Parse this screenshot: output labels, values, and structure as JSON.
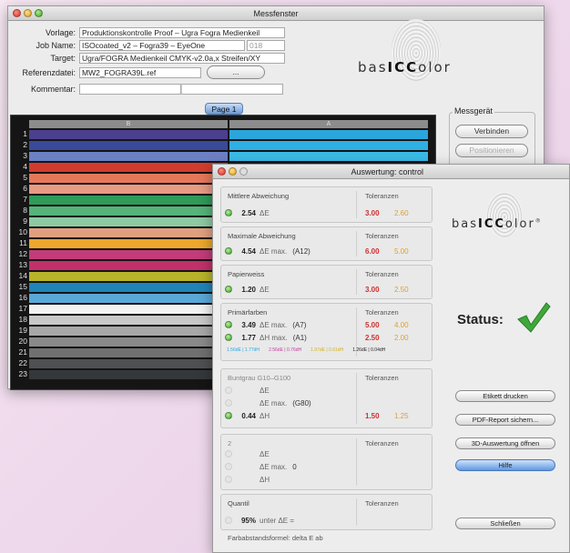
{
  "main": {
    "title": "Messfenster",
    "form": {
      "vorlage_label": "Vorlage:",
      "vorlage": "Produktionskontrolle Proof – Ugra Fogra Medienkeil",
      "job_label": "Job Name:",
      "job": "ISOcoated_v2 – Fogra39 – EyeOne",
      "job_num": "018",
      "target_label": "Target:",
      "target": "Ugra/FOGRA Medienkeil CMYK-v2.0a,x Streifen/XY",
      "ref_label": "Referenzdatei:",
      "ref": "MW2_FOGRA39L.ref",
      "browse": "...",
      "comment_label": "Kommentar:",
      "comment": ""
    },
    "logo": {
      "pre": "bas",
      "mid": "ICC",
      "post": "olor"
    },
    "page_tab": "Page 1",
    "col_b": "B",
    "col_a": "A",
    "rows": [
      "1",
      "2",
      "3",
      "4",
      "5",
      "6",
      "7",
      "8",
      "9",
      "10",
      "11",
      "12",
      "13",
      "14",
      "15",
      "16",
      "17",
      "18",
      "19",
      "20",
      "21",
      "22",
      "23"
    ],
    "colors_b": [
      "#4b3f8f",
      "#3a4a9a",
      "#6c80c4",
      "#d23c2e",
      "#e6785a",
      "#e89a84",
      "#2f9a5a",
      "#56b37a",
      "#8dcaa2",
      "#e0a080",
      "#eda72c",
      "#c23c7a",
      "#c2306a",
      "#b8b42a",
      "#1f84b8",
      "#5aa8d8",
      "#f2f2f2",
      "#c8c8c8",
      "#a8a8a8",
      "#8a8a8a",
      "#707070",
      "#4e5052",
      "#34383a"
    ],
    "colors_a": [
      "#2aa6dc",
      "#2fb0e4",
      "#3bbbe8"
    ],
    "messgeraet": "Messgerät",
    "verbinden": "Verbinden",
    "positionieren": "Positionieren"
  },
  "eval": {
    "title": "Auswertung: control",
    "logo": {
      "pre": "bas",
      "mid": "ICC",
      "post": "olor",
      "reg": "®"
    },
    "status": "Status:",
    "tol": "Toleranzen",
    "s1": {
      "title": "Mittlere Abweichung",
      "v": "2.54",
      "u": "ΔE",
      "t1": "3.00",
      "t2": "2.60"
    },
    "s2": {
      "title": "Maximale Abweichung",
      "v": "4.54",
      "u": "ΔE max.",
      "p": "(A12)",
      "t1": "6.00",
      "t2": "5.00"
    },
    "s3": {
      "title": "Papierweiss",
      "v": "1.20",
      "u": "ΔE",
      "t1": "3.00",
      "t2": "2.50"
    },
    "s4": {
      "title": "Primärfarben",
      "v1": "3.49",
      "u1": "ΔE max.",
      "p1": "(A7)",
      "t11": "5.00",
      "t12": "4.00",
      "v2": "1.77",
      "u2": "ΔH max.",
      "p2": "(A1)",
      "t21": "2.50",
      "t22": "2.00",
      "c1": "1.56dE | 1.77dH",
      "c2": "2.56dE | 0.76dH",
      "c3": "1.97dE | 0.61dH",
      "c4": "1.26dE | 0.04dH"
    },
    "s5": {
      "title": "Buntgrau G10–G100",
      "u1": "ΔE",
      "u2": "ΔE max.",
      "p2": "(G80)",
      "v3": "0.44",
      "u3": "ΔH",
      "t1": "1.50",
      "t2": "1.25"
    },
    "s6": {
      "title": "2",
      "u1": "ΔE",
      "u2": "ΔE max.",
      "v2": "0",
      "u3": "ΔH"
    },
    "s7": {
      "title": "Quantil",
      "v": "95%",
      "u": "unter ΔE ="
    },
    "footer": "Farbabstandsformel: delta E ab",
    "buttons": {
      "etikett": "Etikett drucken",
      "pdf": "PDF-Report sichern...",
      "d3": "3D-Auswertung öffnen",
      "hilfe": "Hilfe",
      "close": "Schließen"
    },
    "status_color": "#3fa83a"
  }
}
